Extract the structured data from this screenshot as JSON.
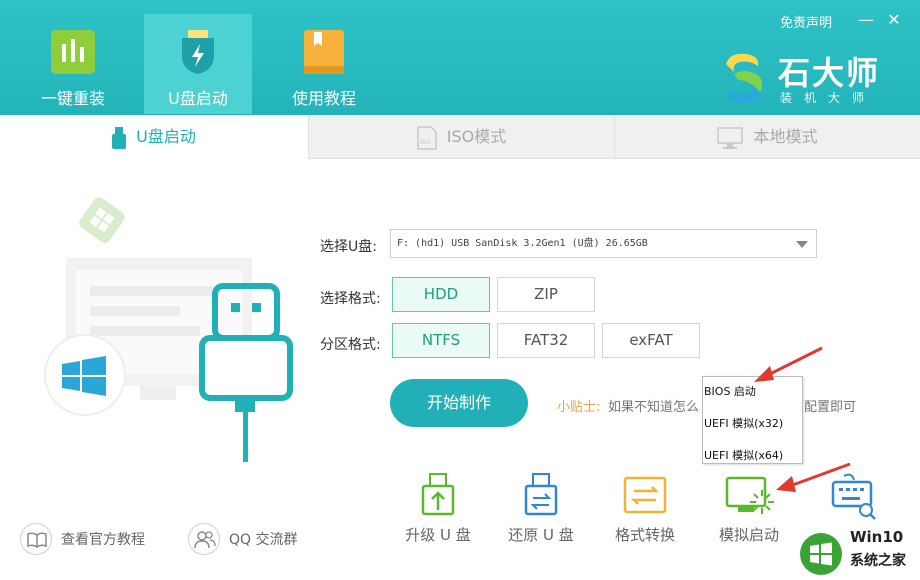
{
  "header": {
    "nav": [
      {
        "label": "一键重装",
        "icon": "bar-chart-icon"
      },
      {
        "label": "U盘启动",
        "icon": "usb-shield-icon"
      },
      {
        "label": "使用教程",
        "icon": "book-icon"
      }
    ],
    "disclaimer": "免责声明",
    "minimize": "—",
    "close": "✕",
    "brand_name": "石大师",
    "brand_sub": "装机大师"
  },
  "subtabs": [
    {
      "label": "U盘启动",
      "icon": "usb-drive-icon"
    },
    {
      "label": "ISO模式",
      "icon": "iso-file-icon"
    },
    {
      "label": "本地模式",
      "icon": "monitor-icon"
    }
  ],
  "form": {
    "usb_label": "选择U盘:",
    "usb_value": "F: (hd1) USB SanDisk 3.2Gen1 (U盘) 26.65GB",
    "format_label": "选择格式:",
    "formats": [
      "HDD",
      "ZIP"
    ],
    "format_selected": "HDD",
    "partition_label": "分区格式:",
    "partitions": [
      "NTFS",
      "FAT32",
      "exFAT"
    ],
    "partition_selected": "NTFS",
    "start_button": "开始制作",
    "tip_key": "小贴士:",
    "tip_text": "如果不知道怎么",
    "tip_tail": "配置即可"
  },
  "popup": {
    "items": [
      "BIOS 启动",
      "UEFI 模拟(x32)",
      "UEFI 模拟(x64)"
    ]
  },
  "tools": [
    {
      "label": "升级 U 盘",
      "icon": "usb-upgrade-icon"
    },
    {
      "label": "还原 U 盘",
      "icon": "usb-restore-icon"
    },
    {
      "label": "格式转换",
      "icon": "format-convert-icon"
    },
    {
      "label": "模拟启动",
      "icon": "simulate-boot-icon"
    },
    {
      "label": "",
      "icon": "keyboard-search-icon"
    }
  ],
  "footer": {
    "tutorial": "查看官方教程",
    "qq_group": "QQ 交流群"
  },
  "watermark": {
    "line1": "Win10",
    "line2": "系统之家"
  },
  "colors": {
    "header_bg": "#23b4b9",
    "accent": "#1fb1b6",
    "selected_option": "#62c9a8",
    "tip_orange": "#f0a23b",
    "arrow_red": "#e03a2f"
  }
}
